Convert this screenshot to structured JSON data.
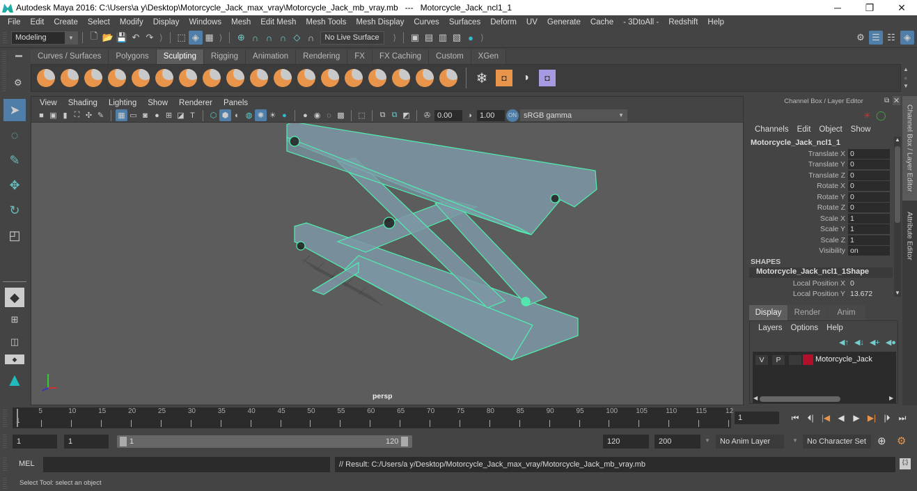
{
  "window": {
    "title": "Autodesk Maya 2016: C:\\Users\\a y\\Desktop\\Motorcycle_Jack_max_vray\\Motorcycle_Jack_mb_vray.mb   ---   Motorcycle_Jack_ncl1_1",
    "minimize": "─",
    "maximize": "❐",
    "close": "✕"
  },
  "menubar": [
    "File",
    "Edit",
    "Create",
    "Select",
    "Modify",
    "Display",
    "Windows",
    "Mesh",
    "Edit Mesh",
    "Mesh Tools",
    "Mesh Display",
    "Curves",
    "Surfaces",
    "Deform",
    "UV",
    "Generate",
    "Cache",
    "- 3DtoAll -",
    "Redshift",
    "Help"
  ],
  "statusline": {
    "mode": "Modeling",
    "live_surface": "No Live Surface"
  },
  "shelf": {
    "tabs": [
      "Curves / Surfaces",
      "Polygons",
      "Sculpting",
      "Rigging",
      "Animation",
      "Rendering",
      "FX",
      "FX Caching",
      "Custom",
      "XGen"
    ],
    "active_tab": "Sculpting",
    "tool_count": 18
  },
  "toolbox": {
    "tools": [
      "select-tool",
      "lasso-tool",
      "paint-select-tool",
      "move-tool",
      "rotate-tool",
      "scale-tool"
    ]
  },
  "viewport": {
    "menu": [
      "View",
      "Shading",
      "Lighting",
      "Show",
      "Renderer",
      "Panels"
    ],
    "exposure": "0.00",
    "gamma": "1.00",
    "color_space": "sRGB gamma",
    "camera_label": "persp",
    "wireframe_color": "#4ef0b0",
    "mesh_color": "#7c98a6"
  },
  "channel_box": {
    "title": "Channel Box / Layer Editor",
    "menu": [
      "Channels",
      "Edit",
      "Object",
      "Show"
    ],
    "object_name": "Motorcycle_Jack_ncl1_1",
    "attributes": [
      {
        "label": "Translate X",
        "value": "0"
      },
      {
        "label": "Translate Y",
        "value": "0"
      },
      {
        "label": "Translate Z",
        "value": "0"
      },
      {
        "label": "Rotate X",
        "value": "0"
      },
      {
        "label": "Rotate Y",
        "value": "0"
      },
      {
        "label": "Rotate Z",
        "value": "0"
      },
      {
        "label": "Scale X",
        "value": "1"
      },
      {
        "label": "Scale Y",
        "value": "1"
      },
      {
        "label": "Scale Z",
        "value": "1"
      },
      {
        "label": "Visibility",
        "value": "on"
      }
    ],
    "shapes_header": "SHAPES",
    "shape_name": "Motorcycle_Jack_ncl1_1Shape",
    "shape_attributes": [
      {
        "label": "Local Position X",
        "value": "0"
      },
      {
        "label": "Local Position Y",
        "value": "13.672"
      }
    ]
  },
  "side_tabs": [
    "Channel Box / Layer Editor",
    "Attribute Editor"
  ],
  "layer_editor": {
    "tabs": [
      "Display",
      "Render",
      "Anim"
    ],
    "active_tab": "Display",
    "menu": [
      "Layers",
      "Options",
      "Help"
    ],
    "layers": [
      {
        "v": "V",
        "p": "P",
        "color": "#b0102a",
        "name": "Motorcycle_Jack"
      }
    ]
  },
  "timeline": {
    "ticks": [
      "5",
      "10",
      "15",
      "20",
      "25",
      "30",
      "35",
      "40",
      "45",
      "50",
      "55",
      "60",
      "65",
      "70",
      "75",
      "80",
      "85",
      "90",
      "95",
      "100",
      "105",
      "110",
      "115",
      "12"
    ],
    "start_label": "1",
    "current_frame": "1"
  },
  "range": {
    "start": "1",
    "playback_start": "1",
    "slider_start": "1",
    "slider_end": "120",
    "playback_end": "120",
    "end": "200",
    "anim_layer": "No Anim Layer",
    "character_set": "No Character Set"
  },
  "command_line": {
    "label": "MEL",
    "input": "",
    "result": "// Result: C:/Users/a y/Desktop/Motorcycle_Jack_max_vray/Motorcycle_Jack_mb_vray.mb"
  },
  "help_line": "Select Tool: select an object"
}
